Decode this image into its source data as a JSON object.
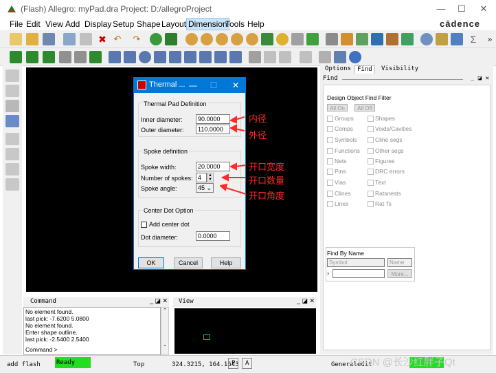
{
  "window": {
    "title": "(Flash) Allegro: myPad.dra  Project: D:/allegroProject",
    "minimize": "—",
    "maximize": "☐",
    "close": "✕"
  },
  "menu": [
    "File",
    "Edit",
    "View",
    "Add",
    "Display",
    "Setup",
    "Shape",
    "Layout",
    "Dimension",
    "Tools",
    "Help"
  ],
  "active_menu": "Dimension",
  "brand": "cādence",
  "dialog": {
    "title": "Thermal ...",
    "group_pad": "Thermal Pad Definition",
    "inner_label": "Inner diameter:",
    "inner_value": "90.0000",
    "outer_label": "Outer diameter:",
    "outer_value": "110.0000",
    "group_spoke": "Spoke definition",
    "width_label": "Spoke width:",
    "width_value": "20.0000",
    "num_label": "Number of spokes:",
    "num_value": "4",
    "angle_label": "Spoke angle:",
    "angle_value": "45",
    "group_center": "Center Dot Option",
    "center_checkbox": "Add center dot",
    "dot_label": "Dot diameter:",
    "dot_value": "0.0000",
    "ok": "OK",
    "cancel": "Cancel",
    "help": "Help"
  },
  "annotations": {
    "inner": "内径",
    "outer": "外径",
    "width": "开口宽度",
    "num": "开口数量",
    "angle": "开口角度"
  },
  "right_panel": {
    "tabs": [
      "Options",
      "Find",
      "Visibility"
    ],
    "active_tab": "Find",
    "header": "Find",
    "filter_title": "Design Object Find Filter",
    "all_on": "All On",
    "all_off": "All Off",
    "items_left": [
      "Groups",
      "Comps",
      "Symbols",
      "Functions",
      "Nets",
      "Pins",
      "Vias",
      "Clines",
      "Lines"
    ],
    "items_right": [
      "Shapes",
      "Voids/Cavities",
      "Cline segs",
      "Other segs",
      "Figures",
      "DRC errors",
      "Text",
      "Ratsnests",
      "Rat Ts"
    ],
    "find_by_name": "Find By Name",
    "symbol_select": "Symbol",
    "name_select": "Name",
    "more": "More..."
  },
  "console": {
    "header": "Command",
    "lines": [
      "No element found.",
      "last pick:  -7.6200 5.0800",
      "No element found.",
      "Enter shape outline.",
      "last pick:  -2.5400 2.5400"
    ],
    "prompt": "Command >"
  },
  "view": {
    "header": "View"
  },
  "status": {
    "mode": "add flash",
    "ready": "Ready",
    "layer": "Top",
    "coords": "324.3215, 164.1643",
    "p": "P",
    "a": "A",
    "general": "General",
    "edit": "edit",
    "watermark": "CSDN @长沙红胖子Qt"
  }
}
